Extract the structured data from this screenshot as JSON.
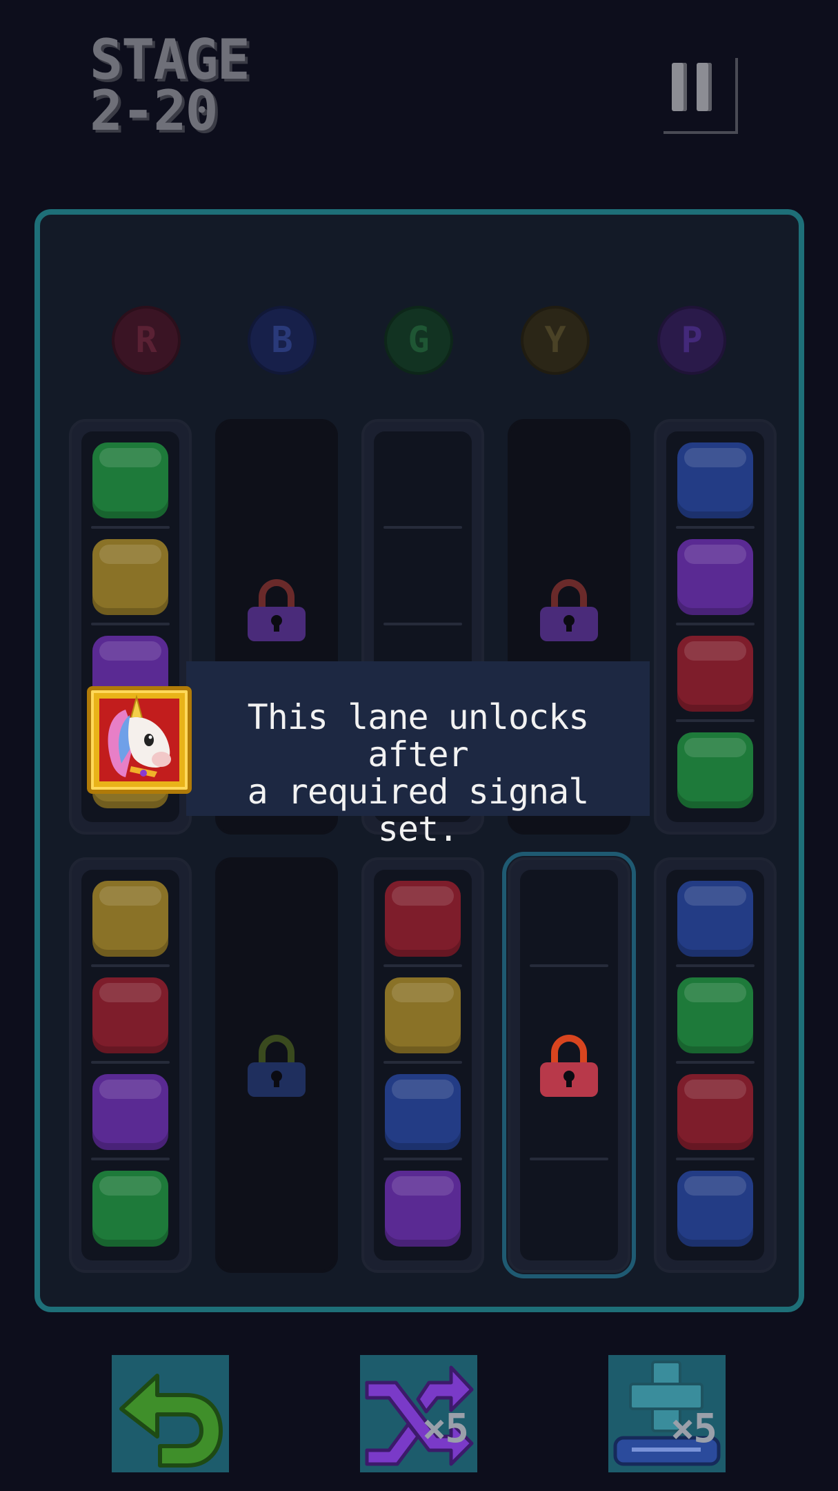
{
  "header": {
    "stage_word": "STAGE",
    "stage_number": "2-20"
  },
  "signals": [
    {
      "letter": "R",
      "color": "#3a1424",
      "text_color": "#5a2134"
    },
    {
      "letter": "B",
      "color": "#17204a",
      "text_color": "#2a3a7a"
    },
    {
      "letter": "G",
      "color": "#123322",
      "text_color": "#1f5634"
    },
    {
      "letter": "Y",
      "color": "#2b2617",
      "text_color": "#4a4226"
    },
    {
      "letter": "P",
      "color": "#2a1a4a",
      "text_color": "#43297a"
    }
  ],
  "lanes_top": [
    {
      "state": "open",
      "blocks": [
        "green",
        "yellow",
        "purple",
        "yellow"
      ]
    },
    {
      "state": "locked",
      "lock_color": "purple"
    },
    {
      "state": "open-empty"
    },
    {
      "state": "locked",
      "lock_color": "purple"
    },
    {
      "state": "open",
      "blocks": [
        "blue",
        "purple",
        "red",
        "green"
      ]
    }
  ],
  "lanes_bottom": [
    {
      "state": "open",
      "blocks": [
        "yellow",
        "red",
        "purple",
        "green"
      ]
    },
    {
      "state": "locked",
      "lock_color": "blue"
    },
    {
      "state": "open",
      "blocks": [
        "red",
        "yellow",
        "blue",
        "purple"
      ]
    },
    {
      "state": "open-empty",
      "lock_color": "red",
      "highlighted": true
    },
    {
      "state": "open",
      "blocks": [
        "blue",
        "green",
        "red",
        "blue"
      ]
    }
  ],
  "tooltip": {
    "text": "This lane unlocks after\na required signal set."
  },
  "buttons": {
    "undo_icon": "undo-arrow-icon",
    "shuffle_icon": "shuffle-icon",
    "shuffle_count": "×5",
    "add_lane_icon": "add-lane-icon",
    "add_lane_count": "×5"
  },
  "colors": {
    "board_border": "#1e6f78",
    "accent": "#1d5c6c"
  }
}
